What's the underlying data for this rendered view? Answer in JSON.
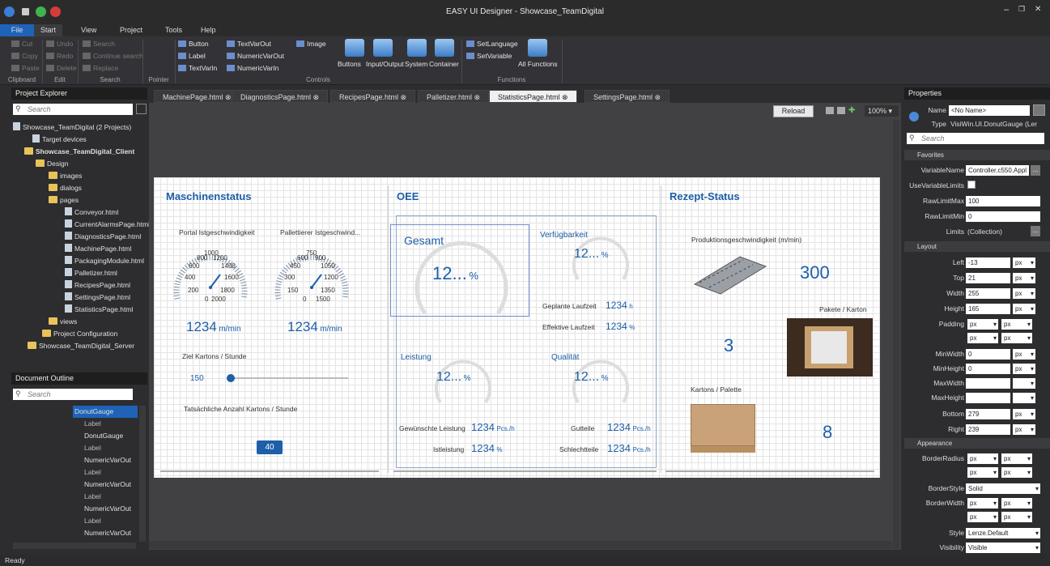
{
  "window": {
    "title": "EASY UI Designer - Showcase_TeamDigital"
  },
  "menu": [
    "File",
    "Start",
    "View",
    "Project",
    "Tools",
    "Help"
  ],
  "ribbon": {
    "clipboard": {
      "cut": "Cut",
      "copy": "Copy",
      "paste": "Paste",
      "group": "Clipboard"
    },
    "edit": {
      "undo": "Undo",
      "redo": "Redo",
      "delete": "Delete",
      "group": "Edit"
    },
    "search": {
      "search": "Search",
      "continue": "Continue search",
      "replace": "Replace",
      "group": "Search"
    },
    "pointer": {
      "group": "Pointer"
    },
    "controls": {
      "button": "Button",
      "label": "Label",
      "textvarin": "TextVarIn",
      "textvarout": "TextVarOut",
      "numericvarout": "NumericVarOut",
      "numericvarin": "NumericVarIn",
      "image": "Image",
      "buttons": "Buttons",
      "io": "Input/Output",
      "system": "System",
      "container": "Container",
      "group": "Controls"
    },
    "functions": {
      "setlanguage": "SetLanguage",
      "setvariable": "SetVariable",
      "all": "All Functions",
      "group": "Functions"
    }
  },
  "explorer": {
    "header": "Project Explorer",
    "search": "Search",
    "items": [
      "Showcase_TeamDigital (2 Projects)",
      "Target devices",
      "Showcase_TeamDigital_Client",
      "Design",
      "images",
      "dialogs",
      "pages",
      "Conveyor.html",
      "CurrentAlarmsPage.html",
      "DiagnosticsPage.html",
      "MachinePage.html",
      "PackagingModule.html",
      "Palletizer.html",
      "RecipesPage.html",
      "SettingsPage.html",
      "StatisticsPage.html",
      "views",
      "Project Configuration",
      "Showcase_TeamDigital_Server"
    ]
  },
  "outline": {
    "header": "Document Outline",
    "search": "Search",
    "items": [
      "DonutGauge",
      "Label",
      "DonutGauge",
      "Label",
      "NumericVarOut",
      "Label",
      "NumericVarOut",
      "Label",
      "NumericVarOut",
      "Label",
      "NumericVarOut"
    ]
  },
  "tabs": [
    "MachinePage.html",
    "DiagnosticsPage.html",
    "RecipesPage.html",
    "Palletizer.html",
    "StatisticsPage.html",
    "SettingsPage.html"
  ],
  "toolbar": {
    "reload": "Reload",
    "zoom": "100%"
  },
  "page": {
    "maschinenstatus": "Maschinenstatus",
    "oee": "OEE",
    "rezept": "Rezept-Status",
    "portal": "Portal Istgeschwindigkeit",
    "palletierer": "Pallettierer Istgeschwind...",
    "gauge1_ticks": [
      "0",
      "200",
      "400",
      "600",
      "800",
      "1000",
      "1200",
      "1400",
      "1600",
      "1800",
      "2000"
    ],
    "gauge2_ticks": [
      "0",
      "150",
      "300",
      "450",
      "600",
      "750",
      "900",
      "1050",
      "1200",
      "1350",
      "1500"
    ],
    "speed1_value": "1234",
    "speed1_unit": "m/min",
    "speed2_value": "1234",
    "speed2_unit": "m/min",
    "ziel": "Ziel Kartons / Stunde",
    "ziel_value": "150",
    "ziel_slider_fraction": 0,
    "tats": "Tatsächliche Anzahl Kartons / Stunde",
    "tats_value": "40",
    "gesamt": "Gesamt",
    "gesamt_value": "12...",
    "pct": "%",
    "verf": "Verfügbarkeit",
    "verf_value": "12...",
    "geplant": "Geplante Laufzeit",
    "geplant_value": "1234",
    "geplant_unit": "h",
    "effektiv": "Effektive Laufzeit",
    "effektiv_value": "1234",
    "effektiv_unit": "%",
    "leistung": "Leistung",
    "leistung_value": "12...",
    "qualitaet": "Qualität",
    "qualitaet_value": "12...",
    "gewuenscht": "Gewünschte Leistung",
    "gewuenscht_value": "1234",
    "gewuenscht_unit": "Pcs./h",
    "ist": "Istleistung",
    "ist_value": "1234",
    "ist_unit": "%",
    "gut": "Gutteile",
    "gut_value": "1234",
    "gut_unit": "Pcs./h",
    "schlecht": "Schlechtteile",
    "schlecht_value": "1234",
    "schlecht_unit": "Pcs./h",
    "prodgeschw": "Produktionsgeschwindigkeit (m/min)",
    "prodgeschw_value": "300",
    "pakete": "Pakete / Karton",
    "pakete_value": "3",
    "kartons": "Kartons / Palette",
    "kartons_value": "8"
  },
  "properties": {
    "header": "Properties",
    "name_label": "Name",
    "name_value": "<No Name>",
    "type_label": "Type",
    "type_value": "VisiWin.UI.DonutGauge (Ler",
    "search": "Search",
    "favorites": "Favorites",
    "variablename": "VariableName",
    "variablename_value": "Controller.c550.Appl",
    "usevariablelimits": "UseVariableLimits",
    "rawlimitmax": "RawLimitMax",
    "rawlimitmax_value": "100",
    "rawlimitmin": "RawLimitMin",
    "rawlimitmin_value": "0",
    "limits": "Limits",
    "limits_value": "(Collection)",
    "layout": "Layout",
    "left": "Left",
    "left_value": "-13",
    "top": "Top",
    "top_value": "21",
    "width": "Width",
    "width_value": "255",
    "height": "Height",
    "height_value": "165",
    "padding": "Padding",
    "minwidth": "MinWidth",
    "minwidth_value": "0",
    "minheight": "MinHeight",
    "minheight_value": "0",
    "maxwidth": "MaxWidth",
    "maxheight": "MaxHeight",
    "bottom": "Bottom",
    "bottom_value": "279",
    "right": "Right",
    "right_value": "239",
    "appearance": "Appearance",
    "borderradius": "BorderRadius",
    "borderstyle": "BorderStyle",
    "borderstyle_value": "Solid",
    "borderwidth": "BorderWidth",
    "style": "Style",
    "style_value": "Lenze.Default",
    "visibility": "Visibility",
    "visibility_value": "Visible",
    "unit": "px"
  },
  "status": "Ready"
}
